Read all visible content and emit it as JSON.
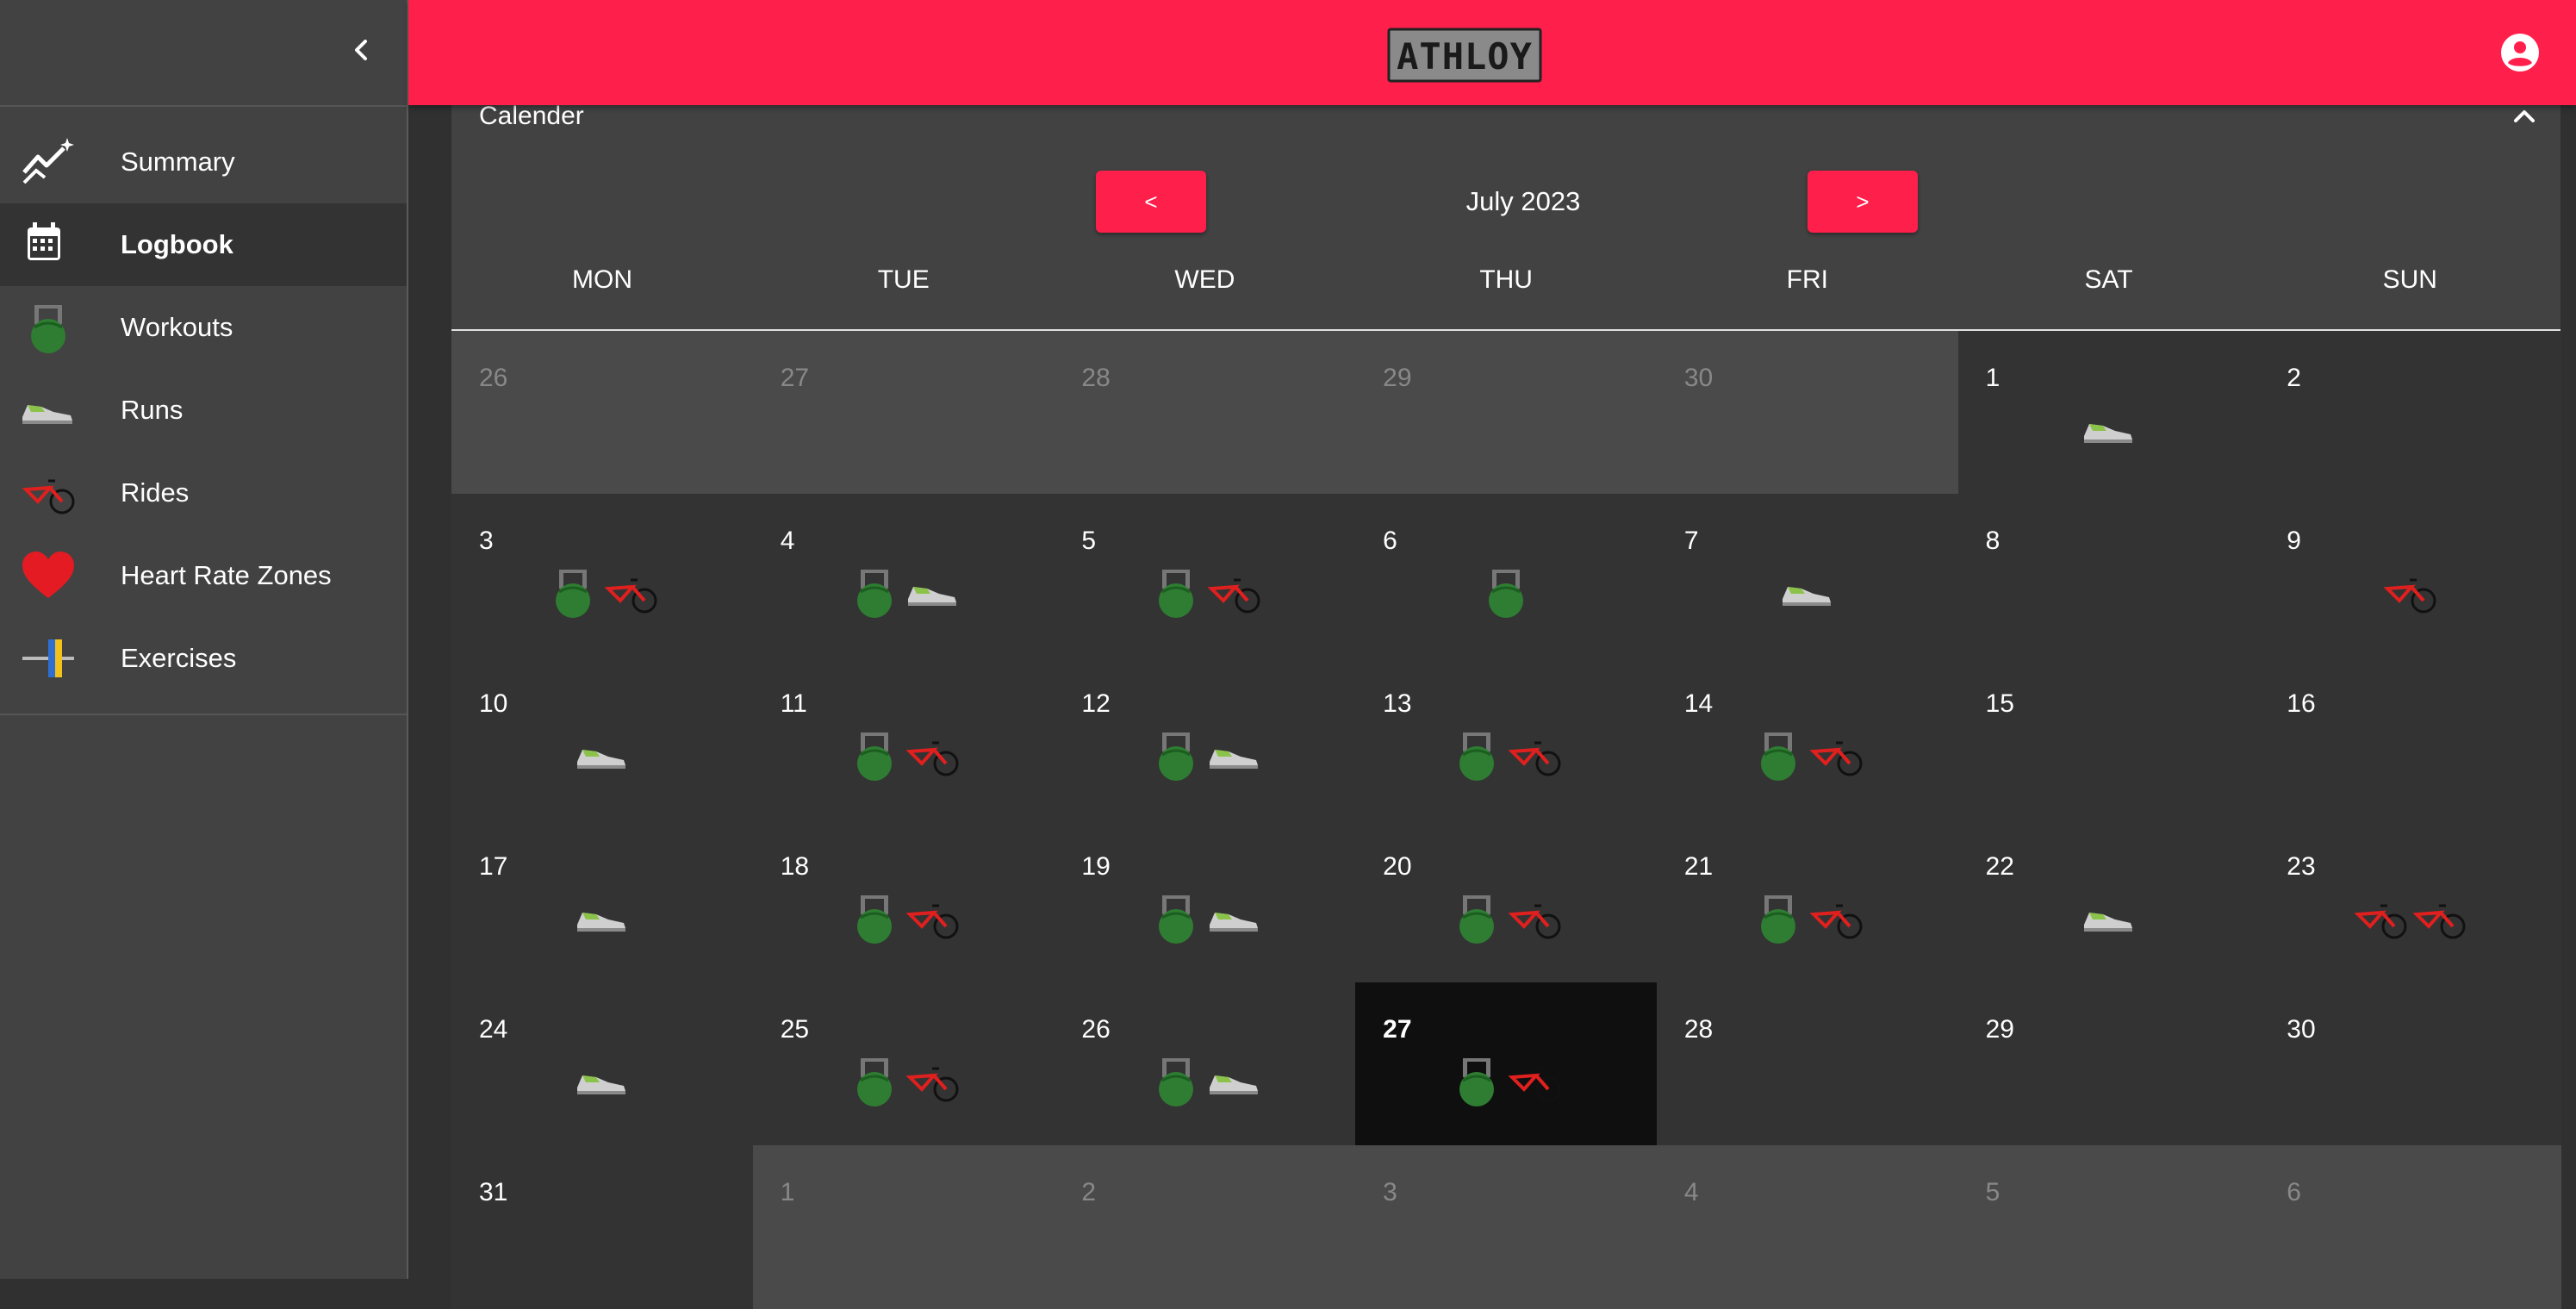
{
  "sidebar": {
    "items": [
      {
        "label": "Summary",
        "icon": "trend-chart-icon"
      },
      {
        "label": "Logbook",
        "icon": "calendar-icon",
        "active": true
      },
      {
        "label": "Workouts",
        "icon": "kettlebell-icon"
      },
      {
        "label": "Runs",
        "icon": "running-shoe-icon"
      },
      {
        "label": "Rides",
        "icon": "bicycle-icon"
      },
      {
        "label": "Heart Rate Zones",
        "icon": "heart-icon"
      },
      {
        "label": "Exercises",
        "icon": "barbell-icon"
      }
    ]
  },
  "header": {
    "logo_text": "ATHLOY",
    "brand_color": "#ff1f4b"
  },
  "calendar": {
    "title": "Calender",
    "prev_label": "<",
    "next_label": ">",
    "month_label": "July 2023",
    "weekdays": [
      "MON",
      "TUE",
      "WED",
      "THU",
      "FRI",
      "SAT",
      "SUN"
    ],
    "today": 27,
    "weeks": [
      [
        {
          "day": "26",
          "other": true,
          "acts": []
        },
        {
          "day": "27",
          "other": true,
          "acts": []
        },
        {
          "day": "28",
          "other": true,
          "acts": []
        },
        {
          "day": "29",
          "other": true,
          "acts": []
        },
        {
          "day": "30",
          "other": true,
          "acts": []
        },
        {
          "day": "1",
          "acts": [
            "run"
          ]
        },
        {
          "day": "2",
          "acts": []
        }
      ],
      [
        {
          "day": "3",
          "acts": [
            "workout",
            "ride"
          ]
        },
        {
          "day": "4",
          "acts": [
            "workout",
            "run"
          ]
        },
        {
          "day": "5",
          "acts": [
            "workout",
            "ride"
          ]
        },
        {
          "day": "6",
          "acts": [
            "workout"
          ]
        },
        {
          "day": "7",
          "acts": [
            "run"
          ]
        },
        {
          "day": "8",
          "acts": []
        },
        {
          "day": "9",
          "acts": [
            "ride"
          ]
        }
      ],
      [
        {
          "day": "10",
          "acts": [
            "run"
          ]
        },
        {
          "day": "11",
          "acts": [
            "workout",
            "ride"
          ]
        },
        {
          "day": "12",
          "acts": [
            "workout",
            "run"
          ]
        },
        {
          "day": "13",
          "acts": [
            "workout",
            "ride"
          ]
        },
        {
          "day": "14",
          "acts": [
            "workout",
            "ride"
          ]
        },
        {
          "day": "15",
          "acts": []
        },
        {
          "day": "16",
          "acts": []
        }
      ],
      [
        {
          "day": "17",
          "acts": [
            "run"
          ]
        },
        {
          "day": "18",
          "acts": [
            "workout",
            "ride"
          ]
        },
        {
          "day": "19",
          "acts": [
            "workout",
            "run"
          ]
        },
        {
          "day": "20",
          "acts": [
            "workout",
            "ride"
          ]
        },
        {
          "day": "21",
          "acts": [
            "workout",
            "ride"
          ]
        },
        {
          "day": "22",
          "acts": [
            "run"
          ]
        },
        {
          "day": "23",
          "acts": [
            "ride",
            "ride"
          ]
        }
      ],
      [
        {
          "day": "24",
          "acts": [
            "run"
          ]
        },
        {
          "day": "25",
          "acts": [
            "workout",
            "ride"
          ]
        },
        {
          "day": "26",
          "acts": [
            "workout",
            "run"
          ]
        },
        {
          "day": "27",
          "acts": [
            "workout",
            "ride"
          ],
          "today": true
        },
        {
          "day": "28",
          "acts": []
        },
        {
          "day": "29",
          "acts": []
        },
        {
          "day": "30",
          "acts": []
        }
      ],
      [
        {
          "day": "31",
          "acts": []
        },
        {
          "day": "1",
          "other": true,
          "acts": []
        },
        {
          "day": "2",
          "other": true,
          "acts": []
        },
        {
          "day": "3",
          "other": true,
          "acts": []
        },
        {
          "day": "4",
          "other": true,
          "acts": []
        },
        {
          "day": "5",
          "other": true,
          "acts": []
        },
        {
          "day": "6",
          "other": true,
          "acts": []
        }
      ]
    ]
  }
}
